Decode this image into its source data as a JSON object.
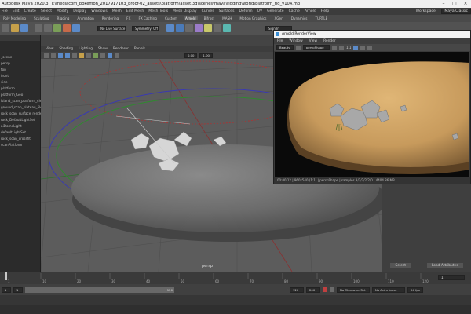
{
  "window": {
    "title": "Autodesk Maya 2020.3: T:\\mediacom_pokemon_2017917103_proof-02_assets\\platform\\asset.3d\\scenes\\maya\\rigging\\world\\platform_rig_v104.mb"
  },
  "menubar": {
    "items": [
      "File",
      "Edit",
      "Create",
      "Select",
      "Modify",
      "Display",
      "Windows",
      "Mesh",
      "Edit Mesh",
      "Mesh Tools",
      "Mesh Display",
      "Curves",
      "Surfaces",
      "Deform",
      "UV",
      "Generate",
      "Cache",
      "Arnold",
      "Help"
    ],
    "workspace_label": "Workspace:",
    "workspace_value": "Maya Classic",
    "signin_label": "Sign In"
  },
  "shelf_tabs": {
    "items": [
      "Poly Modeling",
      "Sculpting",
      "Rigging",
      "Animation",
      "Rendering",
      "FX",
      "FX Caching",
      "Custom",
      "Arnold",
      "Bifrost",
      "MASH",
      "Motion Graphics",
      "XGen",
      "Dynamics",
      "TURTLE"
    ],
    "active": "Arnold"
  },
  "toolbar": {
    "live_surface": "No Live Surface",
    "symmetry": "Symmetry: Off"
  },
  "viewport": {
    "menu": [
      "View",
      "Shading",
      "Lighting",
      "Show",
      "Renderer",
      "Panels"
    ],
    "camera_label": "persp",
    "field_value_a": "0.00",
    "field_value_b": "1.00"
  },
  "outliner": {
    "items": [
      "_scene",
      "persp",
      "top",
      "front",
      "side",
      "platform",
      "platform_Geo",
      "island_scan_platform_clean",
      "ground_scan_plateau_5k",
      "rock_scan_surface_rendertargetset",
      "rock_DefaultLightSet",
      "aiDomeLight",
      "defaultLightSet",
      "rock_scan_crossfit",
      "scanPlatform"
    ]
  },
  "render_view": {
    "title": "Arnold RenderView",
    "menu": [
      "File",
      "Window",
      "View",
      "Render"
    ],
    "status_dropdown": "Beauty",
    "camera_dropdown": "perspShape",
    "ratio": "1:1",
    "status_text": "00:00:12 | 960x540 (1:1) | perspShape | samples 3/2/2/2/2/0 | 4404.86 MB"
  },
  "attr_panel": {
    "select_label": "Select",
    "load_label": "Load Attributes"
  },
  "timeline": {
    "ticks": [
      "1",
      "10",
      "20",
      "30",
      "40",
      "50",
      "60",
      "70",
      "80",
      "90",
      "100",
      "110",
      "120"
    ],
    "range_start": "1",
    "range_inner_start": "1",
    "range_end_inner": "120",
    "range_end": "120",
    "range_max": "200",
    "character_set": "No Character Set",
    "anim_layer": "No Anim Layer",
    "fps": "24 fps",
    "current_frame": "1"
  },
  "colors": {
    "ui_dark": "#2b2b2b",
    "ui_mid": "#444444",
    "viewport_bg": "#5c5c5c",
    "ground": "#c9a36a",
    "accent_blue": "#5b8ac8"
  }
}
